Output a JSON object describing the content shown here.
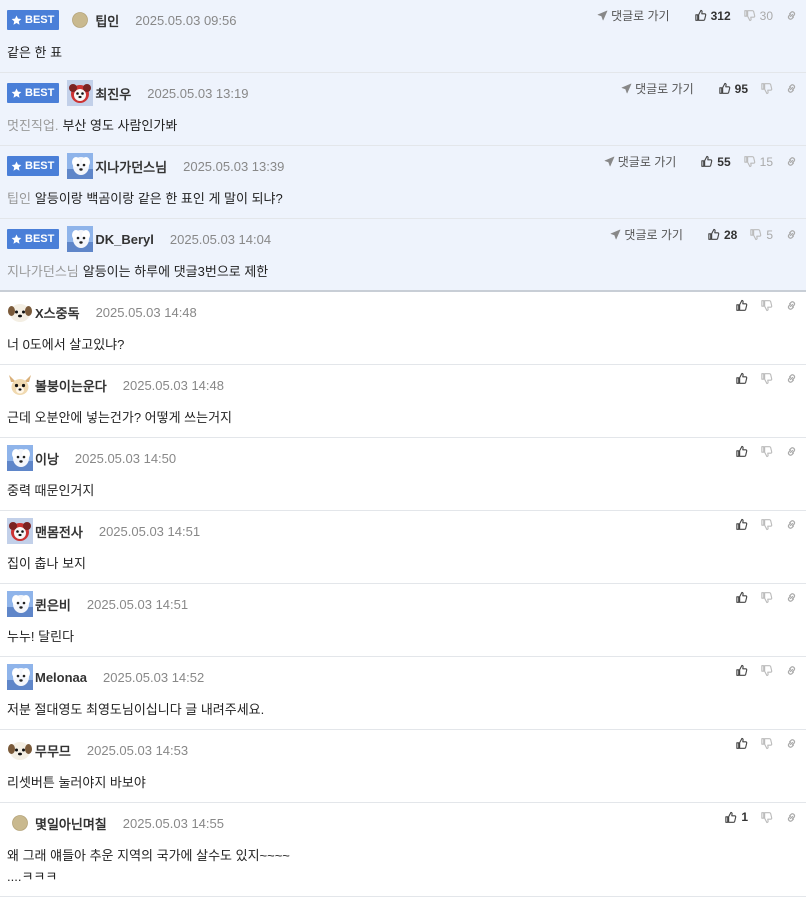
{
  "labels": {
    "best": "BEST",
    "goto_reply": "댓글로 가기"
  },
  "colors": {
    "best_bg": "#eef3fc",
    "badge": "#4a7fd8"
  },
  "comments": [
    {
      "best": true,
      "avatar": "dot-avatar",
      "nick": "팁인",
      "date": "2025.05.03 09:56",
      "reply_to": "",
      "text": "같은 한 표",
      "up": "312",
      "down": "30"
    },
    {
      "best": true,
      "avatar": "dog-avatar-red",
      "nick": "최진우",
      "date": "2025.05.03 13:19",
      "reply_to": "멋진직업.",
      "text": "부산 영도 사람인가봐",
      "up": "95",
      "down": ""
    },
    {
      "best": true,
      "avatar": "dog-avatar-blue",
      "nick": "지나가던스님",
      "date": "2025.05.03 13:39",
      "reply_to": "팁인",
      "text": "알등이랑 백곰이랑 같은 한 표인 게 말이 되냐?",
      "up": "55",
      "down": "15"
    },
    {
      "best": true,
      "avatar": "dog-avatar-blue",
      "nick": "DK_Beryl",
      "date": "2025.05.03 14:04",
      "reply_to": "지나가던스님",
      "text": "알등이는 하루에 댓글3번으로 제한",
      "up": "28",
      "down": "5"
    },
    {
      "best": false,
      "avatar": "puppy-avatar",
      "nick": "X스중독",
      "date": "2025.05.03 14:48",
      "reply_to": "",
      "text": "너 0도에서 살고있냐?",
      "up": "",
      "down": ""
    },
    {
      "best": false,
      "avatar": "chihuahua-avatar",
      "nick": "볼붕이는운다",
      "date": "2025.05.03 14:48",
      "reply_to": "",
      "text": "근데 오분안에 넣는건가? 어떻게 쓰는거지",
      "up": "",
      "down": ""
    },
    {
      "best": false,
      "avatar": "dog-avatar-blue",
      "nick": "이낭",
      "date": "2025.05.03 14:50",
      "reply_to": "",
      "text": "중력 때문인거지",
      "up": "",
      "down": ""
    },
    {
      "best": false,
      "avatar": "dog-avatar-red",
      "nick": "맨몸전사",
      "date": "2025.05.03 14:51",
      "reply_to": "",
      "text": "집이 춥나 보지",
      "up": "",
      "down": ""
    },
    {
      "best": false,
      "avatar": "dog-avatar-blue",
      "nick": "퀸은비",
      "date": "2025.05.03 14:51",
      "reply_to": "",
      "text": "누누! 달린다",
      "up": "",
      "down": ""
    },
    {
      "best": false,
      "avatar": "dog-avatar-blue",
      "nick": "Melonaa",
      "date": "2025.05.03 14:52",
      "reply_to": "",
      "text": "저분 절대영도 최영도님이십니다 글 내려주세요.",
      "up": "",
      "down": ""
    },
    {
      "best": false,
      "avatar": "puppy-avatar",
      "nick": "무무므",
      "date": "2025.05.03 14:53",
      "reply_to": "",
      "text": "리셋버튼 눌러야지 바보야",
      "up": "",
      "down": ""
    },
    {
      "best": false,
      "avatar": "dot-avatar",
      "nick": "몇일아닌며칠",
      "date": "2025.05.03 14:55",
      "reply_to": "",
      "text": "왜 그래 얘들아 추운 지역의 국가에 살수도 있지~~~~",
      "text2": "....ㅋㅋㅋ",
      "up": "1",
      "down": ""
    }
  ]
}
